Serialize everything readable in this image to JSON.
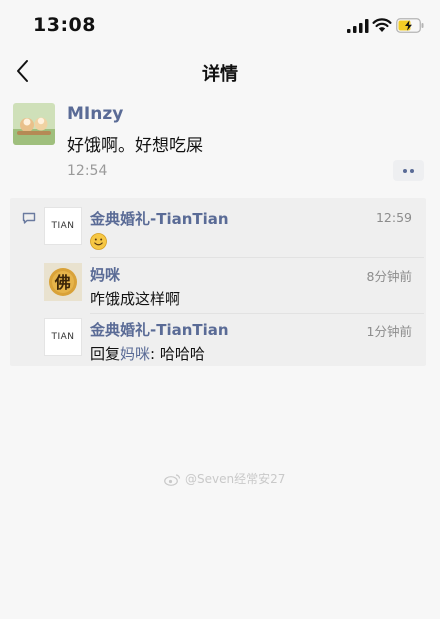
{
  "status_bar": {
    "time": "13:08"
  },
  "nav": {
    "title": "详情"
  },
  "post": {
    "author": "MInzy",
    "content": "好饿啊。好想吃屎",
    "time": "12:54"
  },
  "comments": [
    {
      "name": "金典婚礼-TianTian",
      "time": "12:59",
      "avatar_text": "TIAN",
      "emoji": "smiling-face"
    },
    {
      "name": "妈咪",
      "time": "8分钟前",
      "text": "咋饿成这样啊",
      "avatar_text": "佛"
    },
    {
      "name": "金典婚礼-TianTian",
      "time": "1分钟前",
      "reply_prefix": "回复",
      "reply_to": "妈咪",
      "reply_text": ": 哈哈哈",
      "avatar_text": "TIAN"
    }
  ],
  "watermark": {
    "text": "@Seven经常安27"
  },
  "colors": {
    "link": "#5a6b96",
    "background": "#f7f7f7",
    "panel": "#efefef"
  }
}
